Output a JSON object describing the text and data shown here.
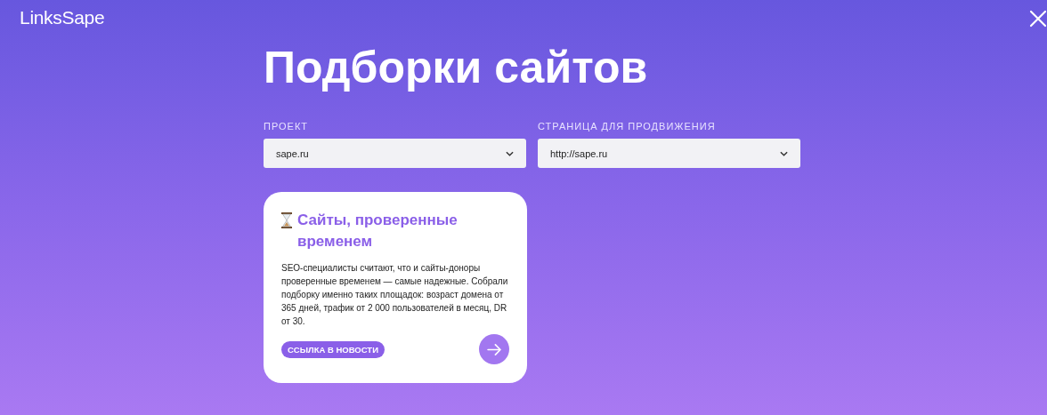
{
  "logo": "LinksSape",
  "title": "Подборки сайтов",
  "fields": [
    {
      "label": "ПРОЕКТ",
      "value": "sape.ru"
    },
    {
      "label": "СТРАНИЦА ДЛЯ ПРОДВИЖЕНИЯ",
      "value": "http://sape.ru"
    }
  ],
  "cards": [
    {
      "title": "Сайты, проверенные временем",
      "text": "SEO-специалисты считают, что и сайты-доноры проверенные временем — самые надежные. Собрали подборку именно таких площадок: возраст домена от 365 дней, трафик от 2 000 пользователей в месяц, DR от 30.",
      "tag": "ССЫЛКА В НОВОСТИ"
    }
  ]
}
